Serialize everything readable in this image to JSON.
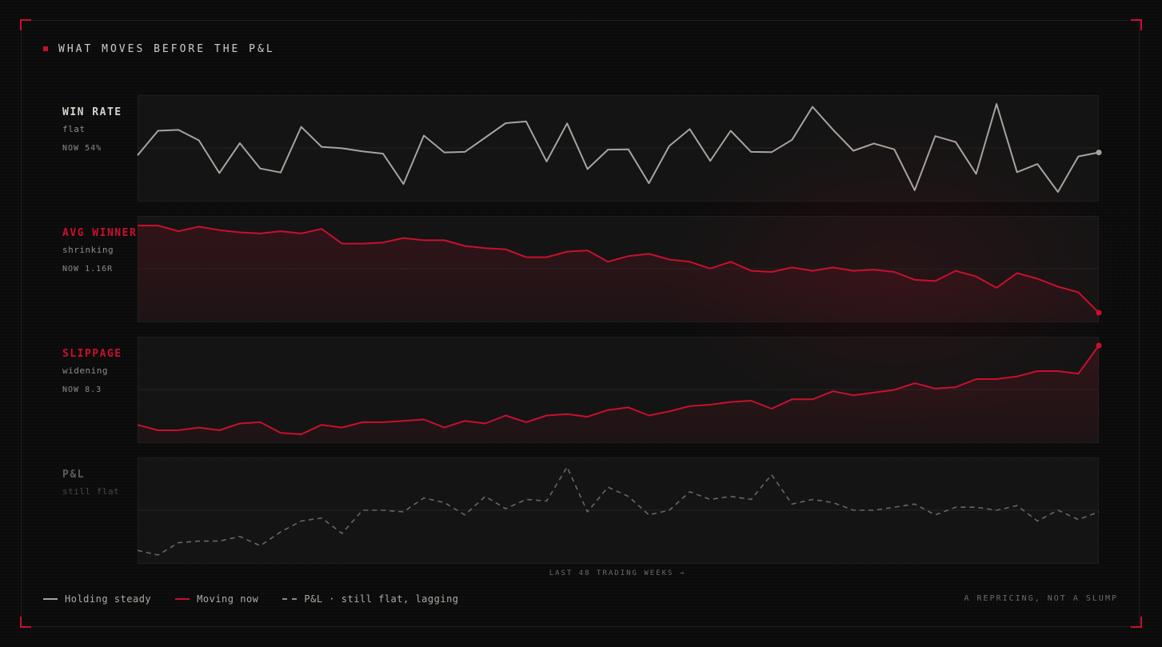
{
  "header": {
    "title": "WHAT MOVES BEFORE THE P&L"
  },
  "panels": [
    {
      "label": "WIN RATE",
      "status": "flat",
      "now": "NOW 54%"
    },
    {
      "label": "AVG WINNER",
      "status": "shrinking",
      "now": "NOW 1.16R"
    },
    {
      "label": "SLIPPAGE",
      "status": "widening",
      "now": "NOW 8.3"
    },
    {
      "label": "P&L",
      "status": "still flat",
      "now": ""
    }
  ],
  "x_axis_label": "LAST 48 TRADING WEEKS →",
  "legend": {
    "steady": "Holding steady",
    "moving": "Moving now",
    "pl": "P&L · still flat, lagging"
  },
  "tagline": "A REPRICING, NOT A SLUMP",
  "colors": {
    "accent": "#c8102e",
    "steady": "#a8a39d",
    "muted": "#6e6b67",
    "background": "#0b0b0b"
  },
  "chart_data": {
    "type": "line",
    "xlabel": "LAST 48 TRADING WEEKS →",
    "x": [
      1,
      2,
      3,
      4,
      5,
      6,
      7,
      8,
      9,
      10,
      11,
      12,
      13,
      14,
      15,
      16,
      17,
      18,
      19,
      20,
      21,
      22,
      23,
      24,
      25,
      26,
      27,
      28,
      29,
      30,
      31,
      32,
      33,
      34,
      35,
      36,
      37,
      38,
      39,
      40,
      41,
      42,
      43,
      44,
      45,
      46,
      47,
      48
    ],
    "series": [
      {
        "name": "WIN RATE",
        "style": "steady",
        "final_label": "NOW 54%",
        "values": [
          53,
          61.7,
          62,
          58.3,
          46.7,
          57.3,
          48.3,
          46.9,
          63.1,
          56,
          55.5,
          54.4,
          53.6,
          42.8,
          60,
          54,
          54.2,
          59.3,
          64.4,
          65,
          50.8,
          64.3,
          48.1,
          55,
          55.1,
          43.1,
          56.3,
          62.3,
          51,
          61.7,
          54.2,
          54.1,
          58.5,
          70.2,
          62.1,
          54.6,
          57.2,
          55.1,
          40.6,
          59.8,
          57.7,
          46.4,
          71.2,
          47,
          49.9,
          40,
          52.6,
          54
        ]
      },
      {
        "name": "AVG WINNER",
        "style": "moving",
        "final_label": "NOW 1.16R",
        "values": [
          1.93,
          1.93,
          1.88,
          1.92,
          1.89,
          1.87,
          1.86,
          1.88,
          1.86,
          1.9,
          1.77,
          1.77,
          1.78,
          1.82,
          1.8,
          1.8,
          1.75,
          1.73,
          1.72,
          1.65,
          1.65,
          1.7,
          1.71,
          1.61,
          1.66,
          1.68,
          1.63,
          1.61,
          1.55,
          1.61,
          1.53,
          1.52,
          1.56,
          1.53,
          1.56,
          1.53,
          1.54,
          1.52,
          1.45,
          1.44,
          1.53,
          1.48,
          1.38,
          1.51,
          1.46,
          1.39,
          1.34,
          1.16
        ]
      },
      {
        "name": "SLIPPAGE",
        "style": "moving",
        "final_label": "NOW 8.3",
        "values": [
          2.4,
          2,
          2,
          2.2,
          2,
          2.5,
          2.6,
          1.8,
          1.7,
          2.4,
          2.2,
          2.6,
          2.6,
          2.7,
          2.8,
          2.2,
          2.7,
          2.5,
          3.1,
          2.6,
          3.1,
          3.2,
          3,
          3.5,
          3.7,
          3.1,
          3.4,
          3.8,
          3.9,
          4.1,
          4.2,
          3.6,
          4.3,
          4.3,
          4.9,
          4.6,
          4.8,
          5,
          5.5,
          5.1,
          5.2,
          5.8,
          5.8,
          6,
          6.4,
          6.4,
          6.2,
          8.3
        ]
      },
      {
        "name": "P&L",
        "style": "pl",
        "values": [
          -26,
          -29,
          -21,
          -20,
          -20,
          -17,
          -23,
          -14,
          -7,
          -5,
          -15,
          0,
          0,
          -1,
          8,
          5,
          -3,
          9,
          1,
          7,
          6,
          28,
          -1,
          15,
          9,
          -3,
          0,
          12,
          7,
          9,
          7,
          23,
          4,
          7,
          5,
          0,
          0,
          2,
          4,
          -3,
          2,
          2,
          0,
          3,
          -7,
          0,
          -6,
          -1
        ]
      }
    ]
  }
}
